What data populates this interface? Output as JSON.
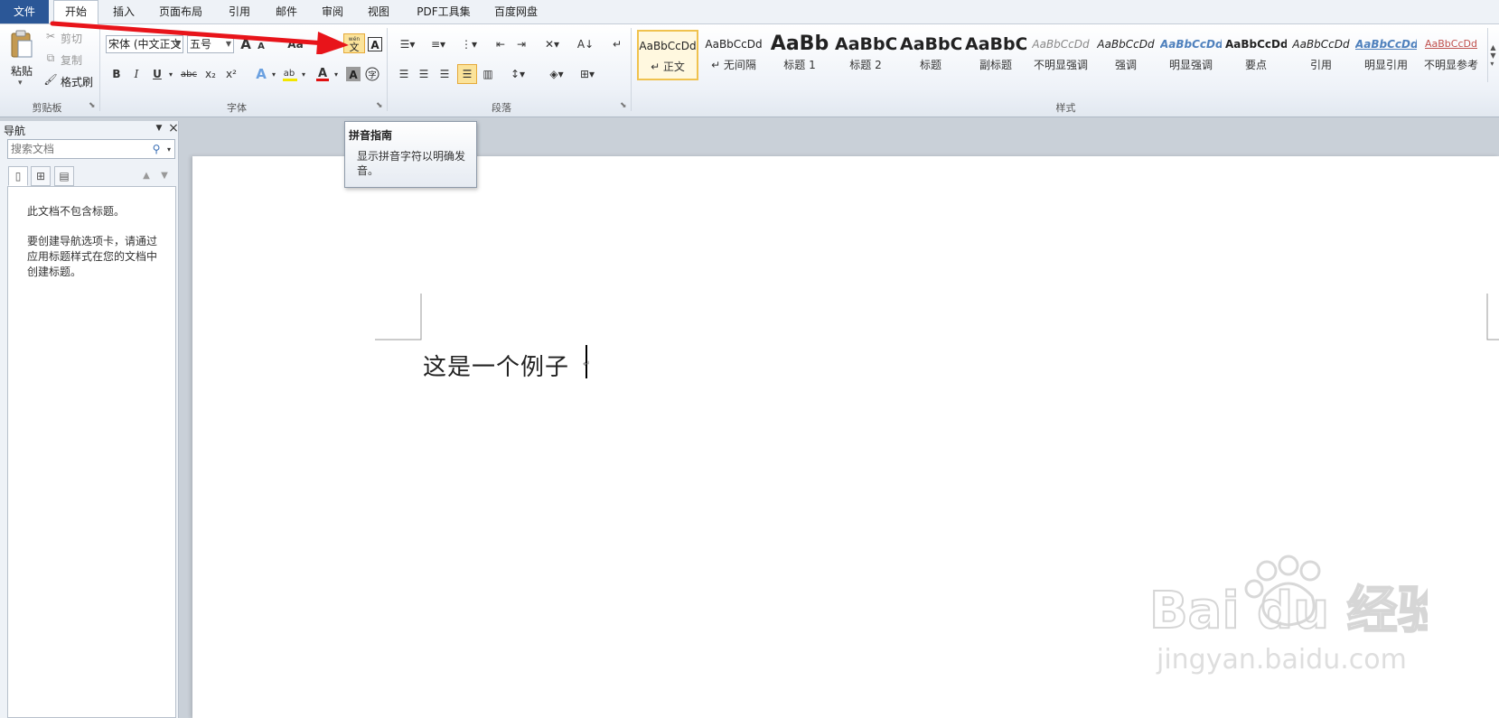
{
  "tabs": [
    "文件",
    "开始",
    "插入",
    "页面布局",
    "引用",
    "邮件",
    "审阅",
    "视图",
    "PDF工具集",
    "百度网盘"
  ],
  "clipboard": {
    "paste": "粘贴",
    "cut": "剪切",
    "copy": "复制",
    "format_painter": "格式刷",
    "group": "剪贴板"
  },
  "font": {
    "name": "宋体 (中文正文",
    "size": "五号",
    "grow": "A",
    "shrink": "A",
    "change_case": "Aa",
    "group": "字体"
  },
  "paragraph": {
    "group": "段落"
  },
  "styles": {
    "group": "样式",
    "items": [
      {
        "sample": "AaBbCcDd",
        "name": "↵ 正文"
      },
      {
        "sample": "AaBbCcDd",
        "name": "↵ 无间隔"
      },
      {
        "sample": "AaBb",
        "name": "标题 1"
      },
      {
        "sample": "AaBbC",
        "name": "标题 2"
      },
      {
        "sample": "AaBbC",
        "name": "标题"
      },
      {
        "sample": "AaBbC",
        "name": "副标题"
      },
      {
        "sample": "AaBbCcDd",
        "name": "不明显强调"
      },
      {
        "sample": "AaBbCcDd",
        "name": "强调"
      },
      {
        "sample": "AaBbCcDd",
        "name": "明显强调"
      },
      {
        "sample": "AaBbCcDd",
        "name": "要点"
      },
      {
        "sample": "AaBbCcDd",
        "name": "引用"
      },
      {
        "sample": "AaBbCcDd",
        "name": "明显引用"
      },
      {
        "sample": "AaBbCcDd",
        "name": "不明显参考"
      }
    ]
  },
  "nav": {
    "title": "导航",
    "search_placeholder": "搜索文档",
    "msg1": "此文档不包含标题。",
    "msg2": "要创建导航选项卡，请通过应用标题样式在您的文档中创建标题。"
  },
  "tooltip": {
    "title": "拼音指南",
    "body": "显示拼音字符以明确发音。"
  },
  "document": {
    "text": "这是一个例子"
  },
  "watermark": {
    "brand": "Bai  du 经验",
    "url": "jingyan.baidu.com"
  },
  "colors": {
    "file_tab": "#2b5797",
    "highlight": "#fbe39a",
    "arrow": "#e8141a"
  },
  "icons": {
    "phonetic": "wén 文"
  }
}
